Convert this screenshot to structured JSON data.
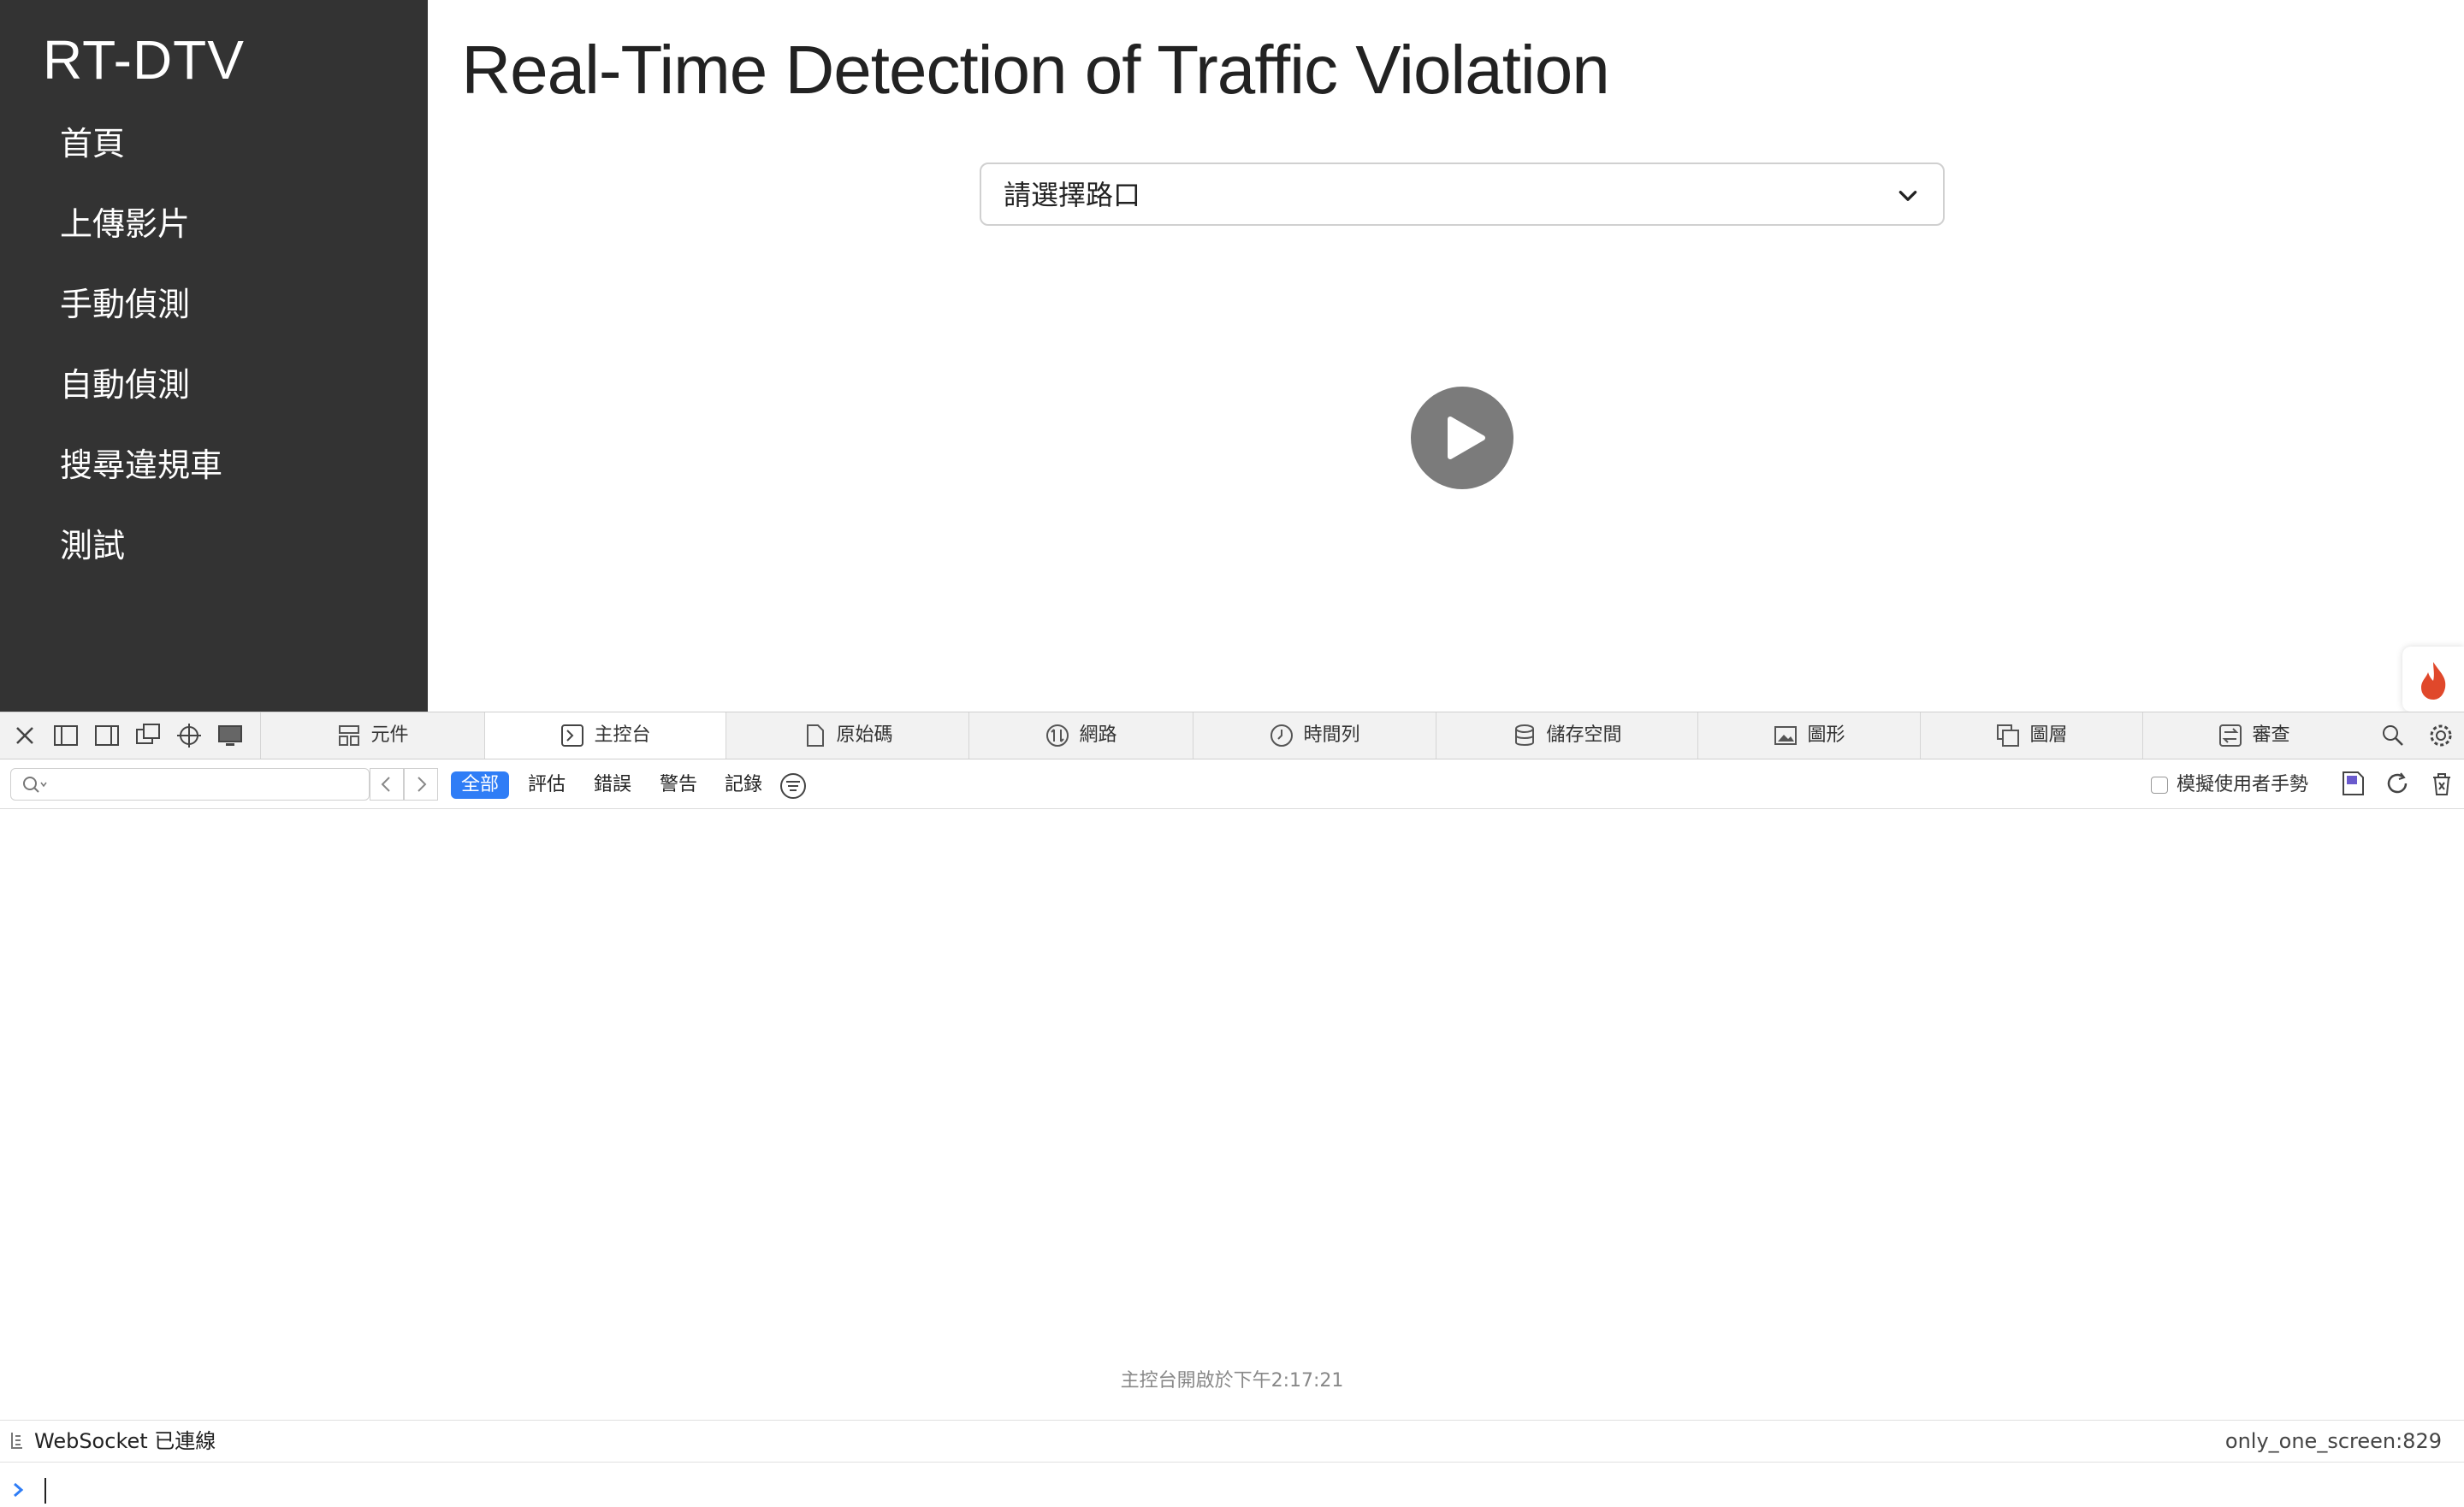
{
  "sidebar": {
    "brand": "RT-DTV",
    "items": [
      {
        "label": "首頁"
      },
      {
        "label": "上傳影片"
      },
      {
        "label": "手動偵測"
      },
      {
        "label": "自動偵測"
      },
      {
        "label": "搜尋違規車"
      },
      {
        "label": "測試"
      }
    ]
  },
  "main": {
    "title": "Real-Time Detection of Traffic Violation",
    "intersection_select": {
      "selected": "請選擇路口"
    },
    "play_button": {
      "icon": "play-icon"
    }
  },
  "devtools": {
    "tabs": [
      {
        "label": "元件",
        "icon": "elements-icon"
      },
      {
        "label": "主控台",
        "icon": "console-icon",
        "active": true
      },
      {
        "label": "原始碼",
        "icon": "sources-icon"
      },
      {
        "label": "網路",
        "icon": "network-icon"
      },
      {
        "label": "時間列",
        "icon": "timeline-icon"
      },
      {
        "label": "儲存空間",
        "icon": "storage-icon"
      },
      {
        "label": "圖形",
        "icon": "graphics-icon"
      },
      {
        "label": "圖層",
        "icon": "layers-icon"
      },
      {
        "label": "審查",
        "icon": "audit-icon"
      }
    ],
    "filters": {
      "all": "全部",
      "evaluations": "評估",
      "errors": "錯誤",
      "warnings": "警告",
      "logs": "記錄"
    },
    "mimic_gestures_label": "模擬使用者手勢",
    "console_opened": "主控台開啟於下午2:17:21",
    "log": {
      "text": "WebSocket 已連線",
      "source": "only_one_screen:829"
    },
    "colors": {
      "accent": "#2f7df6",
      "sidebar_bg": "#333333",
      "play_bg": "#7b7b7b"
    }
  }
}
